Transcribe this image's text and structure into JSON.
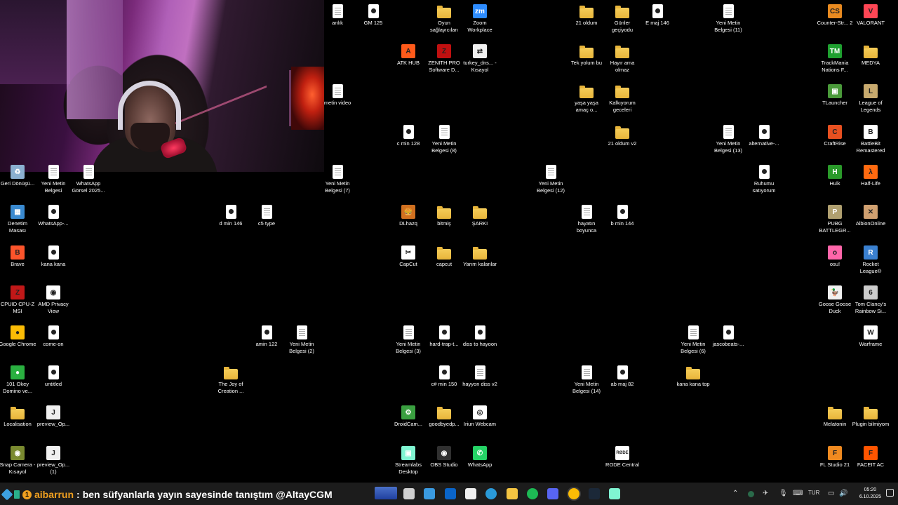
{
  "webcam": {
    "description_visible": true
  },
  "desktop_icons": [
    {
      "label": "anlık",
      "kind": "doc"
    },
    {
      "label": "GM 125",
      "kind": "media"
    },
    {
      "label": "Oyun sağlayıcıları",
      "kind": "folder"
    },
    {
      "label": "Zoom Workplace",
      "kind": "app",
      "color": "#2d8cff",
      "glyph": "zm"
    },
    {
      "label": "21 oldum",
      "kind": "folder"
    },
    {
      "label": "Günler geçiyodu",
      "kind": "folder"
    },
    {
      "label": "E maj 146",
      "kind": "media"
    },
    {
      "label": "Yeni Metin Belgesi (11)",
      "kind": "doc"
    },
    {
      "label": "Counter-Str... 2",
      "kind": "app",
      "color": "#e88a20",
      "glyph": "CS"
    },
    {
      "label": "VALORANT",
      "kind": "app",
      "color": "#ff4655",
      "glyph": "V"
    },
    {
      "label": "ATK HUB",
      "kind": "app",
      "color": "#ff5a1a",
      "glyph": "A"
    },
    {
      "label": "ZENITH PRO Software D...",
      "kind": "app",
      "color": "#c01010",
      "glyph": "Z"
    },
    {
      "label": "turkey_dns... - Kısayol",
      "kind": "app",
      "color": "#f0f0f0",
      "glyph": "⇄"
    },
    {
      "label": "Tek yolum bu",
      "kind": "folder"
    },
    {
      "label": "Hayır ama olmaz",
      "kind": "folder"
    },
    {
      "label": "TrackMania Nations F...",
      "kind": "app",
      "color": "#1fa030",
      "glyph": "TM"
    },
    {
      "label": "MEDYA",
      "kind": "folder"
    },
    {
      "label": "metin video",
      "kind": "doc"
    },
    {
      "label": "yaşa yaşa amaç o...",
      "kind": "folder"
    },
    {
      "label": "Kalkıyorum geceleri",
      "kind": "folder"
    },
    {
      "label": "TLauncher",
      "kind": "app",
      "color": "#4a9a3a",
      "glyph": "▣"
    },
    {
      "label": "League of Legends",
      "kind": "app",
      "color": "#c8aa6e",
      "glyph": "L"
    },
    {
      "label": "c min 128",
      "kind": "media"
    },
    {
      "label": "Yeni Metin Belgesi (8)",
      "kind": "doc"
    },
    {
      "label": "21 oldum v2",
      "kind": "folder"
    },
    {
      "label": "Yeni Metin Belgesi (13)",
      "kind": "doc"
    },
    {
      "label": "alternative-...",
      "kind": "media"
    },
    {
      "label": "CraftRise",
      "kind": "app",
      "color": "#e85020",
      "glyph": "C"
    },
    {
      "label": "BattleBit Remastered",
      "kind": "app",
      "color": "#ffffff",
      "glyph": "B"
    },
    {
      "label": "Geri Dönüşü...",
      "kind": "app",
      "color": "#8ab0d0",
      "glyph": "♻"
    },
    {
      "label": "Yeni Metin Belgesi",
      "kind": "doc"
    },
    {
      "label": "WhatsApp Görsel 2025...",
      "kind": "doc"
    },
    {
      "label": "Yeni Metin Belgesi (7)",
      "kind": "doc"
    },
    {
      "label": "Yeni Metin Belgesi (12)",
      "kind": "doc"
    },
    {
      "label": "Ruhumu satıyorum",
      "kind": "media"
    },
    {
      "label": "Hulk",
      "kind": "app",
      "color": "#2a9a2a",
      "glyph": "H"
    },
    {
      "label": "Half-Life",
      "kind": "app",
      "color": "#ff6a10",
      "glyph": "λ"
    },
    {
      "label": "Denetim Masası",
      "kind": "app",
      "color": "#3a8ad0",
      "glyph": "▦"
    },
    {
      "label": "WhatsApp-...",
      "kind": "media"
    },
    {
      "label": "d min 146",
      "kind": "media"
    },
    {
      "label": "c5 type",
      "kind": "doc"
    },
    {
      "label": "DLhazq",
      "kind": "app",
      "color": "#d07020",
      "glyph": "🍔"
    },
    {
      "label": "bitmiş",
      "kind": "folder"
    },
    {
      "label": "ŞARKI",
      "kind": "folder"
    },
    {
      "label": "hayatın boyunca",
      "kind": "doc"
    },
    {
      "label": "b min 144",
      "kind": "media"
    },
    {
      "label": "PUBG BATTLEGR...",
      "kind": "app",
      "color": "#b0a070",
      "glyph": "P"
    },
    {
      "label": "AlbionOnline",
      "kind": "app",
      "color": "#d0a070",
      "glyph": "✕"
    },
    {
      "label": "Brave",
      "kind": "app",
      "color": "#fb542b",
      "glyph": "B"
    },
    {
      "label": "kana kana",
      "kind": "media"
    },
    {
      "label": "CapCut",
      "kind": "app",
      "color": "#ffffff",
      "glyph": "✂"
    },
    {
      "label": "capcut",
      "kind": "folder"
    },
    {
      "label": "Yarım kalanlar",
      "kind": "folder"
    },
    {
      "label": "osu!",
      "kind": "app",
      "color": "#ff66aa",
      "glyph": "o"
    },
    {
      "label": "Rocket League®",
      "kind": "app",
      "color": "#3a80d0",
      "glyph": "R"
    },
    {
      "label": "CPUID CPU-Z MSI",
      "kind": "app",
      "color": "#c01818",
      "glyph": "Z"
    },
    {
      "label": "AMD Privacy View",
      "kind": "app",
      "color": "#ffffff",
      "glyph": "◉"
    },
    {
      "label": "Goose Goose Duck",
      "kind": "app",
      "color": "#f0f0f0",
      "glyph": "🦆"
    },
    {
      "label": "Tom Clancy's Rainbow Si...",
      "kind": "app",
      "color": "#cccccc",
      "glyph": "6"
    },
    {
      "label": "Google Chrome",
      "kind": "app",
      "color": "#fbbc05",
      "glyph": "●"
    },
    {
      "label": "come-on",
      "kind": "media"
    },
    {
      "label": "amin 122",
      "kind": "media"
    },
    {
      "label": "Yeni Metin Belgesi (2)",
      "kind": "doc"
    },
    {
      "label": "Yeni Metin Belgesi (3)",
      "kind": "doc"
    },
    {
      "label": "hard-trap-t...",
      "kind": "media"
    },
    {
      "label": "diss to hayoon",
      "kind": "media"
    },
    {
      "label": "Yeni Metin Belgesi (6)",
      "kind": "doc"
    },
    {
      "label": "jascobeats-...",
      "kind": "media"
    },
    {
      "label": "Warframe",
      "kind": "app",
      "color": "#ffffff",
      "glyph": "W"
    },
    {
      "label": "101 Okey Domino ve...",
      "kind": "app",
      "color": "#2ab040",
      "glyph": "●"
    },
    {
      "label": "untitled",
      "kind": "media"
    },
    {
      "label": "The Joy of Creation ...",
      "kind": "folder"
    },
    {
      "label": "c# min 150",
      "kind": "media"
    },
    {
      "label": "hayyon diss v2",
      "kind": "doc"
    },
    {
      "label": "Yeni Metin Belgesi (14)",
      "kind": "doc"
    },
    {
      "label": "ab maj 82",
      "kind": "media"
    },
    {
      "label": "kana kana top",
      "kind": "folder"
    },
    {
      "label": "Localisation",
      "kind": "folder"
    },
    {
      "label": "preview_Op...",
      "kind": "app",
      "color": "#f0f0f0",
      "glyph": "J"
    },
    {
      "label": "DroidCam...",
      "kind": "app",
      "color": "#3aa040",
      "glyph": "⚙"
    },
    {
      "label": "goodbyedp...",
      "kind": "folder"
    },
    {
      "label": "Iriun Webcam",
      "kind": "app",
      "color": "#ffffff",
      "glyph": "◎"
    },
    {
      "label": "Melatonin",
      "kind": "folder"
    },
    {
      "label": "Plugin bilmiyom",
      "kind": "folder"
    },
    {
      "label": "Snap Camera - Kısayol",
      "kind": "app",
      "color": "#7a8a30",
      "glyph": "◉"
    },
    {
      "label": "preview_Op... (1)",
      "kind": "app",
      "color": "#f0f0f0",
      "glyph": "J"
    },
    {
      "label": "Streamlabs Desktop",
      "kind": "app",
      "color": "#80f5d2",
      "glyph": "▣"
    },
    {
      "label": "OBS Studio",
      "kind": "app",
      "color": "#303030",
      "glyph": "◉"
    },
    {
      "label": "WhatsApp",
      "kind": "app",
      "color": "#25d366",
      "glyph": "✆"
    },
    {
      "label": "RODE Central",
      "kind": "app",
      "color": "#ffffff",
      "glyph": "RØDE"
    },
    {
      "label": "FL Studio 21",
      "kind": "app",
      "color": "#f08a20",
      "glyph": "F"
    },
    {
      "label": "FACEIT AC",
      "kind": "app",
      "color": "#ff5500",
      "glyph": "F"
    }
  ],
  "chat": {
    "badge_count": "1",
    "username": "aibarrun",
    "separator": ":",
    "message": "ben süfyanlarla yayın sayesinde tanıştım @AltayCGM"
  },
  "taskbar": {
    "apps": [
      {
        "name": "task-view",
        "color": "#d0d0d0"
      },
      {
        "name": "network-app",
        "color": "#3a9ae0"
      },
      {
        "name": "outlook",
        "color": "#0a64c8"
      },
      {
        "name": "store",
        "color": "#f0f0f0"
      },
      {
        "name": "edge",
        "color": "#2a9ad8"
      },
      {
        "name": "file-explorer",
        "color": "#f5c542"
      },
      {
        "name": "spotify",
        "color": "#1db954"
      },
      {
        "name": "discord",
        "color": "#5865f2"
      },
      {
        "name": "chrome",
        "color": "#fbbc05"
      },
      {
        "name": "steam",
        "color": "#1b2838"
      },
      {
        "name": "streamlabs",
        "color": "#80f5d2"
      }
    ],
    "tray": {
      "lang": "TUR",
      "time": "05:20",
      "date": "6.10.2025"
    }
  }
}
